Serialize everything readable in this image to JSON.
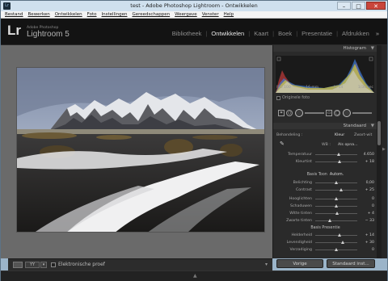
{
  "window": {
    "title": "test - Adobe Photoshop Lightroom - Ontwikkelen",
    "app_icon": "Lr"
  },
  "menu": [
    "Bestand",
    "Bewerken",
    "Ontwikkelen",
    "Foto",
    "Instellingen",
    "Gereedschappen",
    "Weergave",
    "Venster",
    "Help"
  ],
  "brand": {
    "logo": "Lr",
    "small": "Adobe Photoshop",
    "product": "Lightroom 5"
  },
  "modules": [
    "Bibliotheek",
    "Ontwikkelen",
    "Kaart",
    "Boek",
    "Presentatie",
    "Afdrukken"
  ],
  "active_module": "Ontwikkelen",
  "more_modules": "»",
  "histogram": {
    "title": "Histogram",
    "iso": "ISO 100",
    "focal": "16 mm",
    "aperture": "ƒ / 14",
    "shutter": "1/30 sec"
  },
  "original_photo_label": "Originele foto",
  "basic": {
    "preset_label": "Standaard",
    "treatment_label": "Behandeling :",
    "color": "Kleur",
    "bw": "Zwart-wit",
    "wb_label": "WB :",
    "wb_value": "Als opna...",
    "wb_rows": [
      {
        "label": "Temperatuur",
        "value": "4.650",
        "pos": 0.55
      },
      {
        "label": "Kleurtint",
        "value": "+ 18",
        "pos": 0.58
      }
    ],
    "tone_label": "Basis Toon",
    "auto_label": "Autom.",
    "tone_rows": [
      {
        "label": "Belichting",
        "value": "0,00",
        "pos": 0.5
      },
      {
        "label": "Contrast",
        "value": "+ 25",
        "pos": 0.62
      }
    ],
    "tone_rows2": [
      {
        "label": "Hooglichten",
        "value": "0",
        "pos": 0.5
      },
      {
        "label": "Schaduwen",
        "value": "0",
        "pos": 0.5
      },
      {
        "label": "Witte tinten",
        "value": "+ 4",
        "pos": 0.52
      },
      {
        "label": "Zwarte tinten",
        "value": "− 33",
        "pos": 0.34
      }
    ],
    "presence_label": "Basis Presentie",
    "presence_rows": [
      {
        "label": "Helderheid",
        "value": "+ 14",
        "pos": 0.57
      },
      {
        "label": "Levendigheid",
        "value": "+ 30",
        "pos": 0.65
      },
      {
        "label": "Verzadiging",
        "value": "0",
        "pos": 0.5
      }
    ]
  },
  "buttons": {
    "previous": "Vorige",
    "reset": "Standaard inst..."
  },
  "toolbar": {
    "view_mode": "YY",
    "view_extra": "▾",
    "softproof": "Elektronische proef",
    "menu_arrow": "▾"
  },
  "colors": {
    "accent": "#d6d6d6",
    "panel": "#2a2a2a",
    "center": "#6a6a6a"
  }
}
